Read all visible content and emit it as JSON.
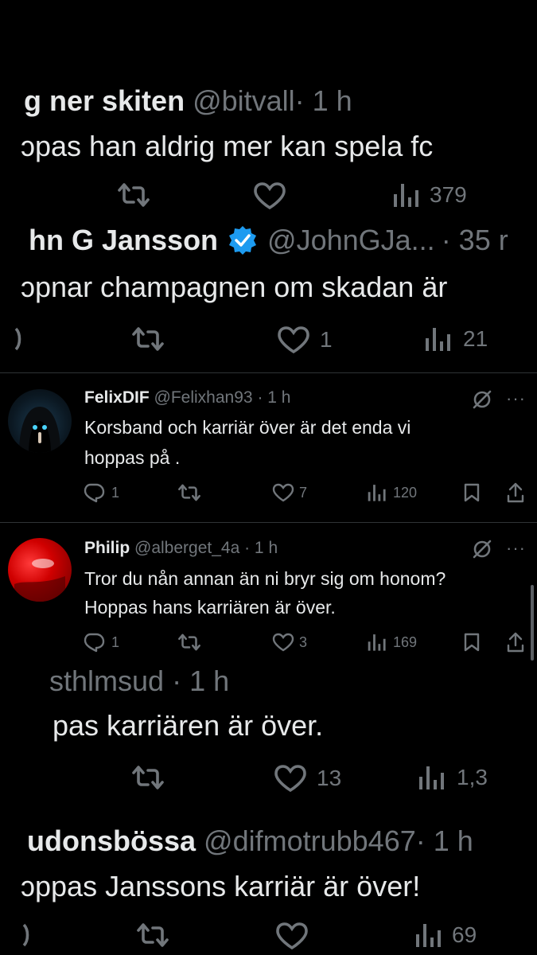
{
  "cropped_posts": [
    {
      "name": "g ner skiten",
      "handle": "@bitvall",
      "time": "· 1 h",
      "body": "ɔpas han aldrig mer kan spela fc",
      "views": "379"
    },
    {
      "name": "hn G Jansson",
      "handle": "@JohnGJa...",
      "time": "· 35 r",
      "body": "ɔpnar champagnen om skadan är ",
      "likes": "1",
      "views": "21"
    },
    {
      "handle": "sthlmsud",
      "time": "· 1 h",
      "body": "pas karriären är över.",
      "likes": "13",
      "views": "1,3"
    },
    {
      "name": "udonsbössa",
      "handle": "@difmotrubb467",
      "time": "· 1 h",
      "body": "ɔppas Janssons karriär är över!",
      "views": "69"
    }
  ],
  "replies": [
    {
      "name": "FelixDIF",
      "handle": "@Felixhan93",
      "time": "· 1 h",
      "body_line1": "Korsband och karriär över är det enda vi",
      "body_line2": "hoppas på .",
      "replies": "1",
      "likes": "7",
      "views": "120"
    },
    {
      "name": "Philip",
      "handle": "@alberget_4a",
      "time": "· 1 h",
      "body_line1": "Tror du nån annan än ni bryr sig om honom?",
      "body_line2": "Hoppas hans karriären är över.",
      "replies": "1",
      "likes": "3",
      "views": "169"
    }
  ],
  "colors": {
    "background": "#000000",
    "text": "#e7e9ea",
    "secondary": "#71767b",
    "verified": "#1d9bf0",
    "divider": "#2f3336"
  }
}
